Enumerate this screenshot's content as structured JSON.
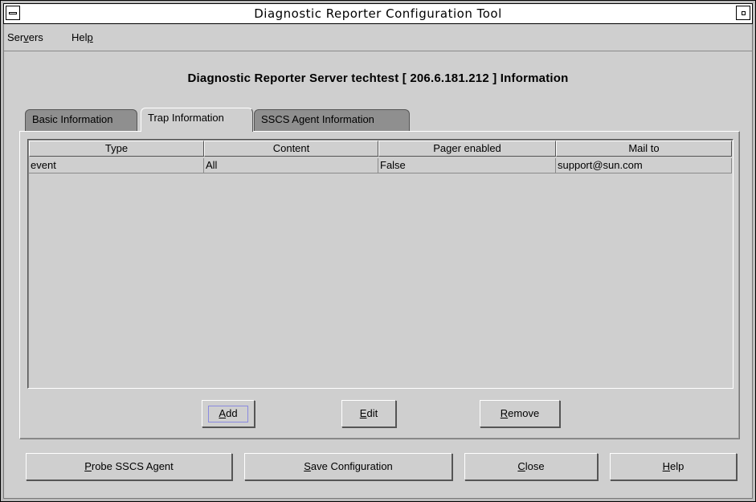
{
  "window": {
    "title": "Diagnostic Reporter Configuration Tool",
    "menu_icon": "window-menu-icon",
    "maximize_icon": "maximize-icon"
  },
  "menubar": {
    "items": [
      {
        "label": "Servers",
        "mnemonic_index": 3
      },
      {
        "label": "Help",
        "mnemonic_index": 3
      }
    ]
  },
  "heading": "Diagnostic Reporter Server techtest  [ 206.6.181.212 ]  Information",
  "tabs": [
    {
      "label": "Basic Information",
      "active": false
    },
    {
      "label": "Trap Information",
      "active": true
    },
    {
      "label": "SSCS Agent Information",
      "active": false
    }
  ],
  "table": {
    "columns": [
      "Type",
      "Content",
      "Pager enabled",
      "Mail to"
    ],
    "rows": [
      [
        "event",
        "All",
        "False",
        "support@sun.com"
      ]
    ]
  },
  "panel_buttons": {
    "add": {
      "mnemonic": "A",
      "rest": "dd"
    },
    "edit": {
      "mnemonic": "E",
      "rest": "dit"
    },
    "remove": {
      "mnemonic": "R",
      "rest": "emove"
    }
  },
  "footer_buttons": {
    "probe": {
      "mnemonic": "P",
      "rest": "robe SSCS Agent"
    },
    "save": {
      "mnemonic": "S",
      "rest": "ave Configuration"
    },
    "close": {
      "mnemonic": "C",
      "rest": "lose"
    },
    "help": {
      "mnemonic": "H",
      "rest": "elp"
    }
  },
  "colors": {
    "window_bg": "#cfcfcf",
    "inactive_tab": "#8f8f8f",
    "focus_ring": "#8a8ae0"
  }
}
